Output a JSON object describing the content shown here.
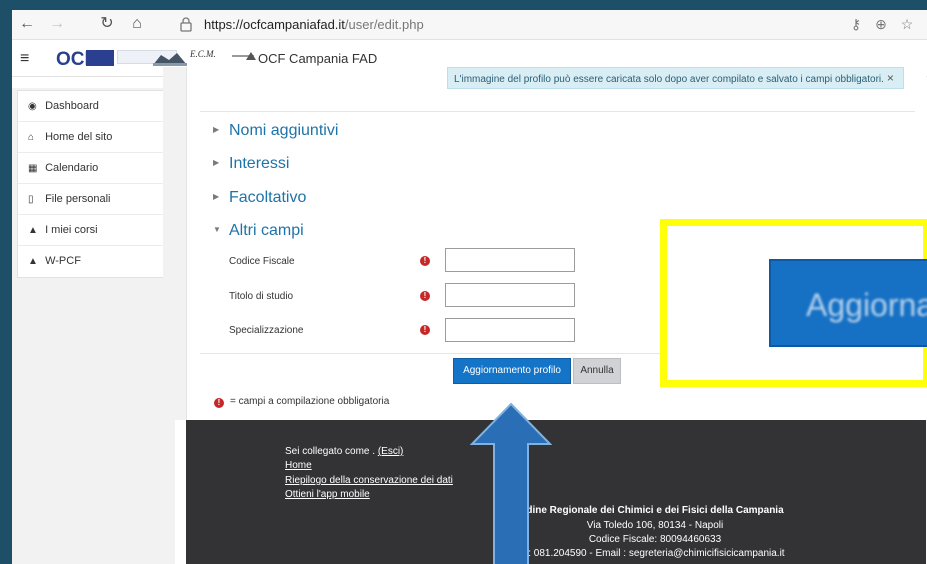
{
  "browser": {
    "url_domain": "https://ocfcampaniafad.it",
    "url_path": "/user/edit.php"
  },
  "navbar": {
    "logo_text": "OCF",
    "ecm_text": "E.C.M.",
    "site_name": "OCF Campania FAD"
  },
  "sidebar": {
    "items": [
      {
        "label": "Dashboard",
        "icon": "dashboard-icon"
      },
      {
        "label": "Home del sito",
        "icon": "home-icon"
      },
      {
        "label": "Calendario",
        "icon": "calendar-icon"
      },
      {
        "label": "File personali",
        "icon": "file-icon"
      },
      {
        "label": "I miei corsi",
        "icon": "graduation-cap-icon"
      },
      {
        "label": "W-PCF",
        "icon": "graduation-cap-icon"
      }
    ]
  },
  "alert": {
    "text": "L'immagine del profilo può essere caricata solo dopo aver compilato e salvato i campi obbligatori.",
    "close": "×"
  },
  "sections": [
    {
      "label": "Nomi aggiuntivi"
    },
    {
      "label": "Interessi"
    },
    {
      "label": "Facoltativo"
    },
    {
      "label": "Altri campi"
    }
  ],
  "fields": [
    {
      "label": "Codice Fiscale",
      "value": ""
    },
    {
      "label": "Titolo di studio",
      "value": ""
    },
    {
      "label": "Specializzazione",
      "value": ""
    }
  ],
  "buttons": {
    "update": "Aggiornamento profilo",
    "cancel": "Annulla"
  },
  "legend": {
    "required_text": "= campi a compilazione obbligatoria",
    "required_mark": "!"
  },
  "callout": {
    "zoom_text": "Aggiorna"
  },
  "footer": {
    "logged_in": "Sei collegato come . ",
    "logout": "(Esci)",
    "links": [
      "Home",
      "Riepilogo della conservazione dei dati",
      "Ottieni l'app mobile"
    ],
    "org_name": "dine Regionale dei Chimici e dei Fisici della Campania",
    "address": "Via Toledo 106, 80134 - Napoli",
    "fiscal_code": "Codice Fiscale: 80094460633",
    "contacts": ".: 081.204590 - Email : segreteria@chimicifisicicampania.it"
  },
  "colors": {
    "accent": "#1374c8",
    "section_link": "#1e73a8",
    "highlight": "#ffff0a",
    "arrow": "#2a6fb5"
  }
}
